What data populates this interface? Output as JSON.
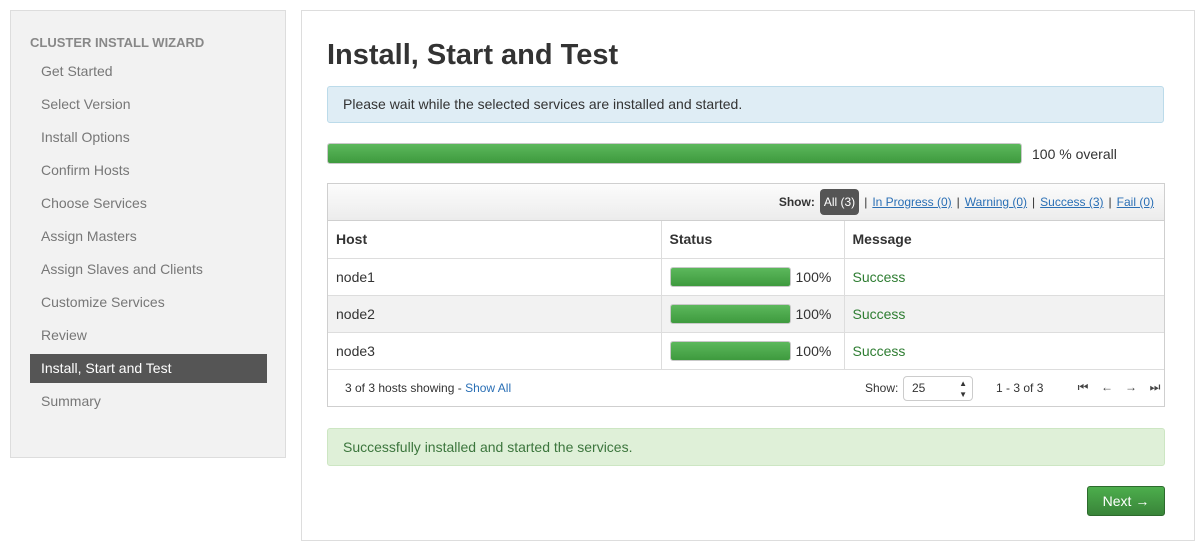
{
  "sidebar": {
    "header": "CLUSTER INSTALL WIZARD",
    "items": [
      {
        "label": "Get Started",
        "active": false
      },
      {
        "label": "Select Version",
        "active": false
      },
      {
        "label": "Install Options",
        "active": false
      },
      {
        "label": "Confirm Hosts",
        "active": false
      },
      {
        "label": "Choose Services",
        "active": false
      },
      {
        "label": "Assign Masters",
        "active": false
      },
      {
        "label": "Assign Slaves and Clients",
        "active": false
      },
      {
        "label": "Customize Services",
        "active": false
      },
      {
        "label": "Review",
        "active": false
      },
      {
        "label": "Install, Start and Test",
        "active": true
      },
      {
        "label": "Summary",
        "active": false
      }
    ]
  },
  "main": {
    "title": "Install, Start and Test",
    "info_message": "Please wait while the selected services are installed and started.",
    "overall_progress": 100,
    "overall_text": "100 % overall",
    "filter": {
      "show_label": "Show:",
      "all": "All (3)",
      "in_progress": "In Progress (0)",
      "warning": "Warning (0)",
      "success": "Success (3)",
      "fail": "Fail (0)",
      "separator": "|"
    },
    "table": {
      "headers": [
        "Host",
        "Status",
        "Message"
      ],
      "rows": [
        {
          "host": "node1",
          "progress": 100,
          "progress_text": "100%",
          "message": "Success"
        },
        {
          "host": "node2",
          "progress": 100,
          "progress_text": "100%",
          "message": "Success"
        },
        {
          "host": "node3",
          "progress": 100,
          "progress_text": "100%",
          "message": "Success"
        }
      ]
    },
    "footer": {
      "count_text": "3 of 3 hosts showing - ",
      "show_all": "Show All",
      "show_label": "Show:",
      "page_size": "25",
      "range": "1 - 3 of 3",
      "pager_icons": [
        "first-page-icon",
        "prev-page-icon",
        "next-page-icon",
        "last-page-icon"
      ]
    },
    "success_message": "Successfully installed and started the services.",
    "next_label": "Next →"
  },
  "colors": {
    "progress_green": "#4cae4c",
    "active_nav": "#555555",
    "link_blue": "#2a6fb5",
    "success_text": "#2e7d32"
  }
}
